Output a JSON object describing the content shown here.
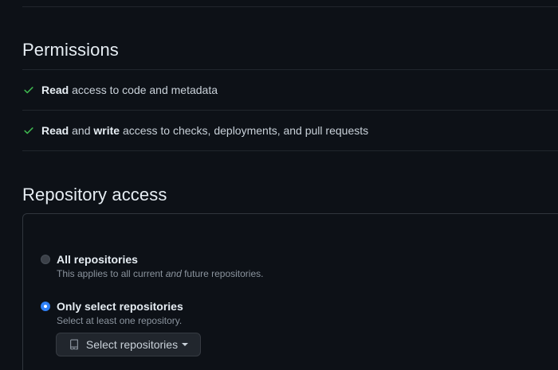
{
  "permissions": {
    "title": "Permissions",
    "items": [
      {
        "bold1": "Read",
        "rest": " access to code and metadata"
      },
      {
        "bold1": "Read",
        "mid": " and ",
        "bold2": "write",
        "rest": " access to checks, deployments, and pull requests"
      }
    ]
  },
  "repository_access": {
    "title": "Repository access",
    "options": [
      {
        "label": "All repositories",
        "desc_before": "This applies to all current ",
        "desc_italic": "and",
        "desc_after": " future repositories.",
        "selected": false
      },
      {
        "label": "Only select repositories",
        "desc": "Select at least one repository.",
        "selected": true
      }
    ],
    "select_button_label": "Select repositories"
  },
  "colors": {
    "background": "#0d1117",
    "check": "#3fb950",
    "radio_selected": "#2f81f7"
  },
  "icons": {
    "check": "check-icon",
    "repo": "repo-icon",
    "caret": "caret-down-icon"
  }
}
